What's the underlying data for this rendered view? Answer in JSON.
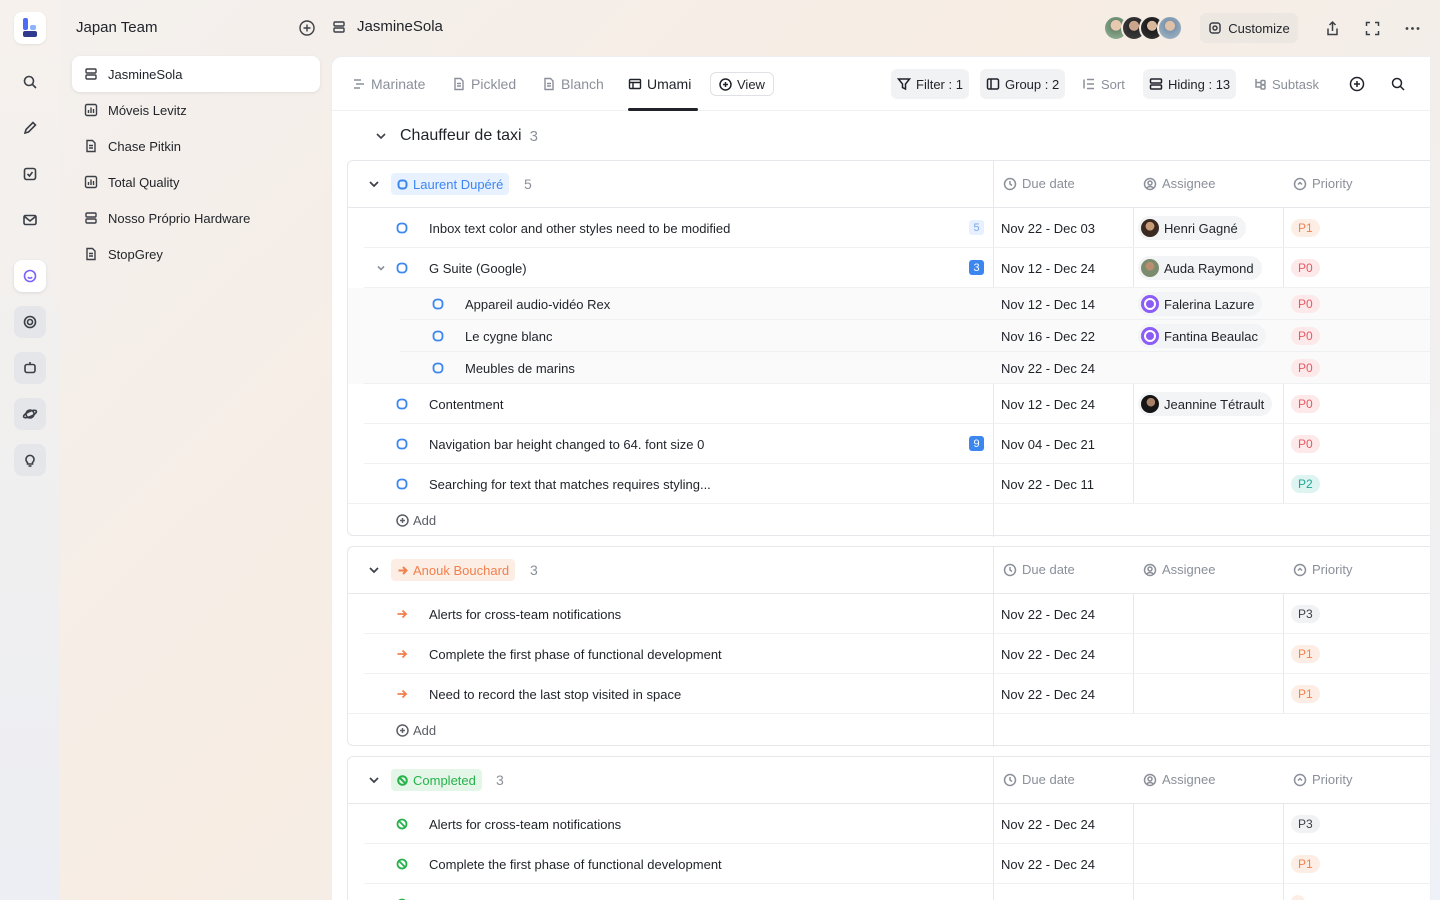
{
  "sidebar": {
    "team_name": "Japan Team",
    "items": [
      {
        "label": "JasmineSola",
        "icon": "database-icon"
      },
      {
        "label": "Móveis Levitz",
        "icon": "chart-icon"
      },
      {
        "label": "Chase Pitkin",
        "icon": "document-icon"
      },
      {
        "label": "Total Quality",
        "icon": "chart-icon"
      },
      {
        "label": "Nosso Próprio Hardware",
        "icon": "database-icon"
      },
      {
        "label": "StopGrey",
        "icon": "document-icon"
      }
    ]
  },
  "header": {
    "title": "JasmineSola",
    "customize_label": "Customize"
  },
  "tabs": [
    {
      "label": "Marinate"
    },
    {
      "label": "Pickled"
    },
    {
      "label": "Blanch"
    },
    {
      "label": "Umami"
    }
  ],
  "view_label": "View",
  "toolbar": {
    "filter": "Filter : 1",
    "group": "Group : 2",
    "sort": "Sort",
    "hiding": "Hiding : 13",
    "subtask": "Subtask"
  },
  "group": {
    "title": "Chauffeur de taxi",
    "count": "3"
  },
  "columns": {
    "due": "Due date",
    "assignee": "Assignee",
    "priority": "Priority"
  },
  "add_label": "Add",
  "sections": [
    {
      "tag": "Laurent Dupéré",
      "count": "5",
      "rows": [
        {
          "title": "Inbox text color and other styles need to be modified",
          "badge": "5",
          "due": "Nov 22 - Dec 03",
          "assignee": "Henri Gagné",
          "priority": "P1"
        },
        {
          "title": "G Suite (Google)",
          "badge": "3",
          "due": "Nov 12 - Dec 24",
          "assignee": "Auda Raymond",
          "priority": "P0"
        },
        {
          "title": "Appareil audio-vidéo Rex",
          "due": "Nov 12 - Dec 14",
          "assignee": "Falerina Lazure",
          "priority": "P0"
        },
        {
          "title": "Le cygne blanc",
          "due": "Nov 16 - Dec 22",
          "assignee": "Fantina Beaulac",
          "priority": "P0"
        },
        {
          "title": "Meubles de marins",
          "due": "Nov 22 - Dec 24",
          "priority": "P0"
        },
        {
          "title": "Contentment",
          "due": "Nov 12 - Dec 24",
          "assignee": "Jeannine Tétrault",
          "priority": "P0"
        },
        {
          "title": "Navigation bar height changed to 64. font size 0",
          "badge": "9",
          "due": "Nov 04 - Dec 21",
          "priority": "P0"
        },
        {
          "title": "Searching for text that matches requires styling...",
          "due": "Nov 22 - Dec 11",
          "priority": "P2"
        }
      ]
    },
    {
      "tag": "Anouk Bouchard",
      "count": "3",
      "rows": [
        {
          "title": "Alerts for cross-team notifications",
          "due": "Nov 22 - Dec 24",
          "priority": "P3"
        },
        {
          "title": "Complete the first phase of functional development",
          "due": "Nov 22 - Dec 24",
          "priority": "P1"
        },
        {
          "title": "Need to record the last stop visited in space",
          "due": "Nov 22 - Dec 24",
          "priority": "P1"
        }
      ]
    },
    {
      "tag": "Completed",
      "count": "3",
      "rows": [
        {
          "title": "Alerts for cross-team notifications",
          "due": "Nov 22 - Dec 24",
          "priority": "P3"
        },
        {
          "title": "Complete the first phase of functional development",
          "due": "Nov 22 - Dec 24",
          "priority": "P1"
        }
      ]
    }
  ]
}
